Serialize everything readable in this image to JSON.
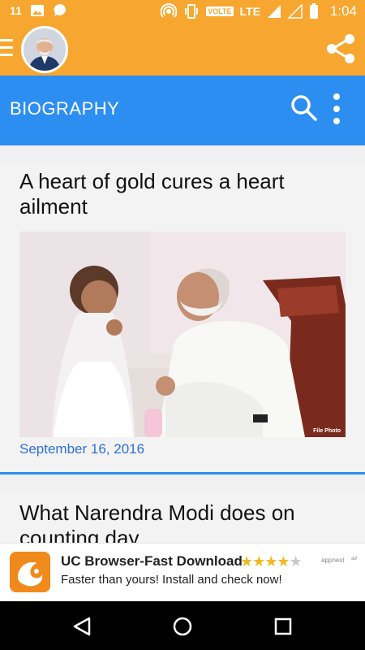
{
  "status_bar": {
    "notification_count": "11",
    "network_badge": "VOLTE",
    "network_type": "LTE",
    "time": "1:04",
    "icons": [
      "gallery-icon",
      "chat-icon",
      "hotspot-icon",
      "vibrate-icon",
      "signal-icon",
      "battery-icon"
    ]
  },
  "app_header": {
    "menu_icon": "hamburger-icon",
    "avatar_alt": "profile-avatar",
    "share_icon": "share-icon",
    "background_color": "#f7a730"
  },
  "title_bar": {
    "title": "BIOGRAPHY",
    "search_icon": "search-icon",
    "more_icon": "more-vertical-icon",
    "background_color": "#2d8ef1"
  },
  "articles": [
    {
      "title": "A heart of gold cures a heart ailment",
      "image_caption": "File Photo",
      "date": "September 16, 2016"
    },
    {
      "title": "What Narendra Modi does on counting day"
    }
  ],
  "ad": {
    "title": "UC Browser-Fast Download",
    "description": "Faster than yours! Install and check now!",
    "rating_stars": 4.5,
    "network": "appnext",
    "badge": "ad",
    "icon": "uc-browser-icon"
  },
  "nav_bar": {
    "back_icon": "back-triangle-icon",
    "home_icon": "home-circle-icon",
    "recents_icon": "recents-square-icon"
  }
}
